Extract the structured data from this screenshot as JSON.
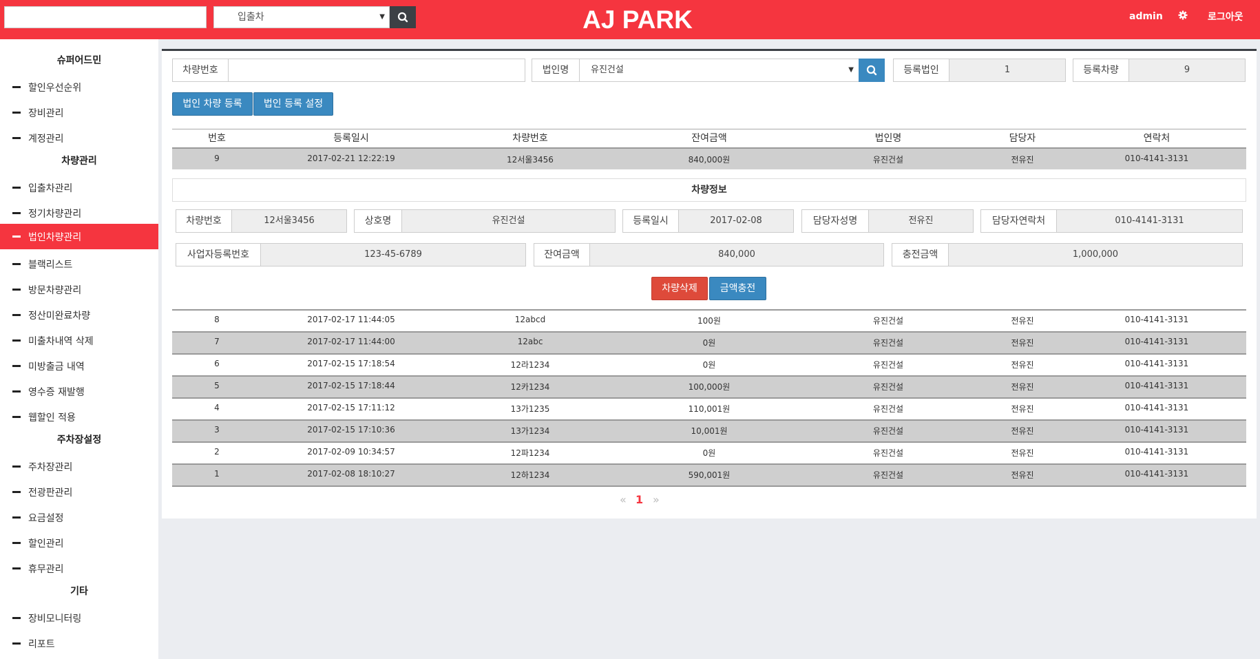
{
  "header": {
    "brand": "AJ PARK",
    "search_value": "",
    "select_value": "입출차",
    "user": "admin",
    "logout": "로그아웃",
    "accent_color": "#f5353f"
  },
  "sidebar": {
    "groups": [
      {
        "title": "슈퍼어드민",
        "items": [
          "할인우선순위",
          "장비관리",
          "계정관리"
        ]
      },
      {
        "title": "차량관리",
        "items": [
          "입출차관리",
          "정기차량관리",
          "법인차량관리",
          "블랙리스트",
          "방문차량관리",
          "정산미완료차량",
          "미출차내역 삭제",
          "미방출금 내역",
          "영수증 재발행",
          "웹할인 적용"
        ]
      },
      {
        "title": "주차장설정",
        "items": [
          "주차장관리",
          "전광판관리",
          "요금설정",
          "할인관리",
          "휴무관리"
        ]
      },
      {
        "title": "기타",
        "items": [
          "장비모니터링",
          "리포트"
        ]
      }
    ],
    "active_item": "법인차량관리"
  },
  "filters": {
    "car_number_label": "차량번호",
    "car_number_value": "",
    "corp_label": "법인명",
    "corp_value": "유진건설",
    "reg_corp_label": "등록법인",
    "reg_corp_value": "1",
    "reg_car_label": "등록차량",
    "reg_car_value": "9"
  },
  "actions": {
    "register_car": "법인 차량 등록",
    "register_setting": "법인 등록 설정"
  },
  "table": {
    "columns": [
      "번호",
      "등록일시",
      "차량번호",
      "잔여금액",
      "법인명",
      "담당자",
      "연락처"
    ],
    "selected_row": {
      "no": "9",
      "date": "2017-02-21 12:22:19",
      "car": "12서울3456",
      "balance": "840,000원",
      "corp": "유진건설",
      "manager": "전유진",
      "phone": "010-4141-3131"
    },
    "rows": [
      {
        "no": "8",
        "date": "2017-02-17 11:44:05",
        "car": "12abcd",
        "balance": "100원",
        "corp": "유진건설",
        "manager": "전유진",
        "phone": "010-4141-3131"
      },
      {
        "no": "7",
        "date": "2017-02-17 11:44:00",
        "car": "12abc",
        "balance": "0원",
        "corp": "유진건설",
        "manager": "전유진",
        "phone": "010-4141-3131"
      },
      {
        "no": "6",
        "date": "2017-02-15 17:18:54",
        "car": "12라1234",
        "balance": "0원",
        "corp": "유진건설",
        "manager": "전유진",
        "phone": "010-4141-3131"
      },
      {
        "no": "5",
        "date": "2017-02-15 17:18:44",
        "car": "12카1234",
        "balance": "100,000원",
        "corp": "유진건설",
        "manager": "전유진",
        "phone": "010-4141-3131"
      },
      {
        "no": "4",
        "date": "2017-02-15 17:11:12",
        "car": "13가1235",
        "balance": "110,001원",
        "corp": "유진건설",
        "manager": "전유진",
        "phone": "010-4141-3131"
      },
      {
        "no": "3",
        "date": "2017-02-15 17:10:36",
        "car": "13가1234",
        "balance": "10,001원",
        "corp": "유진건설",
        "manager": "전유진",
        "phone": "010-4141-3131"
      },
      {
        "no": "2",
        "date": "2017-02-09 10:34:57",
        "car": "12파1234",
        "balance": "0원",
        "corp": "유진건설",
        "manager": "전유진",
        "phone": "010-4141-3131"
      },
      {
        "no": "1",
        "date": "2017-02-08 18:10:27",
        "car": "12하1234",
        "balance": "590,001원",
        "corp": "유진건설",
        "manager": "전유진",
        "phone": "010-4141-3131"
      }
    ]
  },
  "detail": {
    "title": "차량정보",
    "car_number_label": "차량번호",
    "car_number_value": "12서울3456",
    "company_label": "상호명",
    "company_value": "유진건설",
    "reg_date_label": "등록일시",
    "reg_date_value": "2017-02-08",
    "manager_label": "담당자성명",
    "manager_value": "전유진",
    "contact_label": "담당자연락처",
    "contact_value": "010-4141-3131",
    "biz_no_label": "사업자등록번호",
    "biz_no_value": "123-45-6789",
    "balance_label": "잔여금액",
    "balance_value": "840,000",
    "charge_label": "충전금액",
    "charge_value": "1,000,000",
    "delete_button": "차량삭제",
    "charge_button": "금액충전"
  },
  "pagination": {
    "prev": "«",
    "current": "1",
    "next": "»"
  }
}
